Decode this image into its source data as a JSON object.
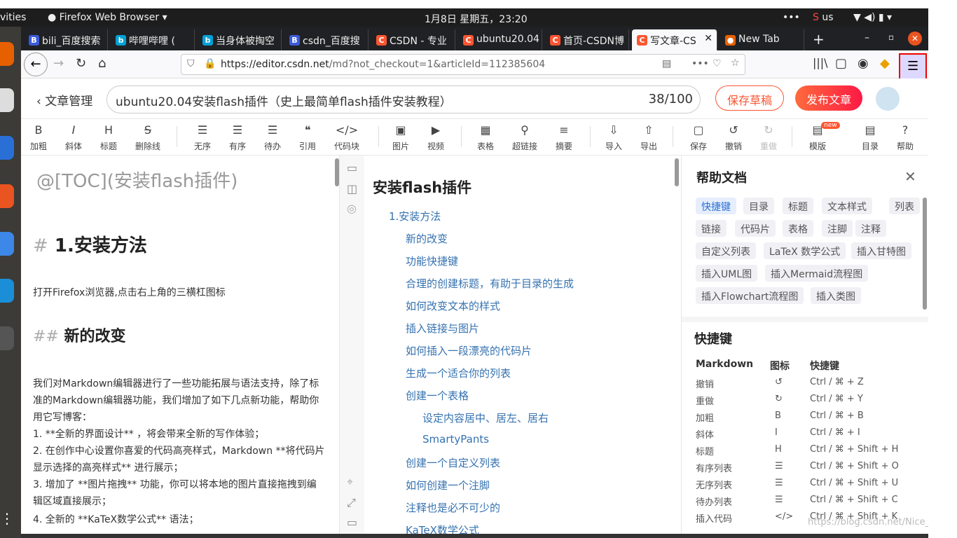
{
  "os": {
    "activities": "vities",
    "app_menu": "Firefox Web Browser ▾",
    "clock": "1月8日 星期五，23:20",
    "dots": "•••",
    "input_method": "us"
  },
  "tabs": [
    {
      "label": "bili_百度搜索",
      "favicon": "B"
    },
    {
      "label": "哔哩哔哩 (",
      "favicon": "b"
    },
    {
      "label": "当身体被掏空",
      "favicon": "b"
    },
    {
      "label": "csdn_百度搜",
      "favicon": "B"
    },
    {
      "label": "CSDN - 专业",
      "favicon": "C"
    },
    {
      "label": "ubuntu20.04",
      "favicon": "C"
    },
    {
      "label": "首页-CSDN博",
      "favicon": "C"
    },
    {
      "label": "写文章-CS",
      "favicon": "C"
    },
    {
      "label": "New Tab",
      "favicon": "●"
    }
  ],
  "nav": {
    "url_host": "https://editor.csdn.net",
    "url_path": "/md?not_checkout=1&articleId=112385604",
    "more": "•••"
  },
  "header": {
    "back_label": "文章管理",
    "title": "ubuntu20.04安装flash插件（史上最简单flash插件安装教程）",
    "count": "38/100",
    "save_draft": "保存草稿",
    "publish": "发布文章"
  },
  "toolbar": [
    "加粗",
    "斜体",
    "标题",
    "删除线",
    "无序",
    "有序",
    "待办",
    "引用",
    "代码块",
    "图片",
    "视频",
    "表格",
    "超链接",
    "摘要",
    "导入",
    "导出",
    "保存",
    "撤销",
    "重做",
    "模版",
    "目录",
    "帮助"
  ],
  "toolbar_icons": [
    "B",
    "I",
    "H",
    "S",
    "☰",
    "☰",
    "☰",
    "❝",
    "</>",
    "▣",
    "▶",
    "▦",
    "⚲",
    "≡",
    "⇩",
    "⇧",
    "▢",
    "↺",
    "↻",
    "▤",
    "▤",
    "?"
  ],
  "toolbar_new": "new",
  "editor": {
    "toc_line": "@[TOC](安装flash插件)",
    "h1_mark": "#",
    "h1_text": "1.安装方法",
    "p1": "打开Firefox浏览器,点击右上角的三横杠图标",
    "h2_mark": "##",
    "h2_text": "新的改变",
    "p2": "我们对Markdown编辑器进行了一些功能拓展与语法支持，除了标准的Markdown编辑器功能，我们增加了如下几点新功能，帮助你用它写博客：",
    "li1": "1. **全新的界面设计** ，将会带来全新的写作体验；",
    "li2": "2. 在创作中心设置你喜爱的代码高亮样式，Markdown **将代码片显示选择的高亮样式** 进行展示；",
    "li3": "3. 增加了 **图片拖拽** 功能，你可以将本地的图片直接拖拽到编辑区域直接展示；",
    "li4": "4. 全新的 **KaTeX数学公式** 语法；"
  },
  "preview": {
    "title": "安装flash插件",
    "toc": [
      {
        "label": "1.安装方法",
        "level": 1
      },
      {
        "label": "新的改变",
        "level": 2
      },
      {
        "label": "功能快捷键",
        "level": 2
      },
      {
        "label": "合理的创建标题，有助于目录的生成",
        "level": 2
      },
      {
        "label": "如何改变文本的样式",
        "level": 2
      },
      {
        "label": "插入链接与图片",
        "level": 2
      },
      {
        "label": "如何插入一段漂亮的代码片",
        "level": 2
      },
      {
        "label": "生成一个适合你的列表",
        "level": 2
      },
      {
        "label": "创建一个表格",
        "level": 2
      },
      {
        "label": "设定内容居中、居左、居右",
        "level": 3
      },
      {
        "label": "SmartyPants",
        "level": 3
      },
      {
        "label": "创建一个自定义列表",
        "level": 2
      },
      {
        "label": "如何创建一个注脚",
        "level": 2
      },
      {
        "label": "注释也是必不可少的",
        "level": 2
      },
      {
        "label": "KaTeX数学公式",
        "level": 2
      }
    ]
  },
  "help": {
    "title": "帮助文档",
    "tags": [
      "快捷键",
      "目录",
      "标题",
      "文本样式",
      "列表",
      "链接",
      "代码片",
      "表格",
      "注脚",
      "注释",
      "自定义列表",
      "LaTeX 数学公式",
      "插入甘特图",
      "插入UML图",
      "插入Mermaid流程图",
      "插入Flowchart流程图",
      "插入类图"
    ],
    "section": "快捷键",
    "columns": [
      "Markdown",
      "图标",
      "快捷键"
    ],
    "rows": [
      {
        "name": "撤销",
        "icon": "↺",
        "key": "Ctrl / ⌘ + Z"
      },
      {
        "name": "重做",
        "icon": "↻",
        "key": "Ctrl / ⌘ + Y"
      },
      {
        "name": "加粗",
        "icon": "B",
        "key": "Ctrl / ⌘ + B"
      },
      {
        "name": "斜体",
        "icon": "I",
        "key": "Ctrl / ⌘ + I"
      },
      {
        "name": "标题",
        "icon": "H",
        "key": "Ctrl / ⌘ + Shift + H"
      },
      {
        "name": "有序列表",
        "icon": "☰",
        "key": "Ctrl / ⌘ + Shift + O"
      },
      {
        "name": "无序列表",
        "icon": "☰",
        "key": "Ctrl / ⌘ + Shift + U"
      },
      {
        "name": "待办列表",
        "icon": "☰",
        "key": "Ctrl / ⌘ + Shift + C"
      },
      {
        "name": "插入代码",
        "icon": "</>",
        "key": "Ctrl / ⌘ + Shift + K"
      }
    ],
    "watermark": "https://blog.csdn.net/Nice_"
  },
  "colors": {
    "accent": "#fc5531",
    "link": "#3572b0",
    "tabbar": "#202124"
  }
}
